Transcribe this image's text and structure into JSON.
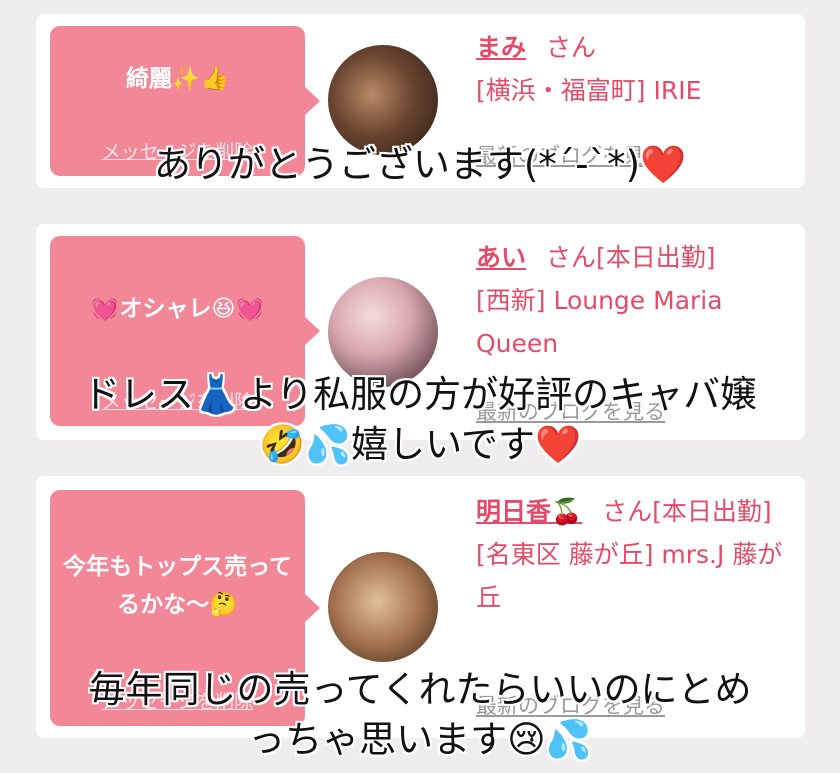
{
  "cards": [
    {
      "message": "綺麗✨👍",
      "delete_label": "メッセージを削除",
      "name": "まみ",
      "honorific": "さん",
      "shop": "[横浜・福富町] IRIE",
      "latest_blog": "最新のブログを見る"
    },
    {
      "message": "💓オシャレ😆💓",
      "delete_label": "メッセージを削除",
      "name": "あい",
      "honorific": "さん[本日出勤]",
      "shop": "[西新] Lounge Maria Queen",
      "latest_blog": "最新のブログを見る"
    },
    {
      "message": "今年もトップス売ってるかな〜🤔",
      "delete_label": "メッセージを削除",
      "name": "明日香🍒",
      "honorific": "さん[本日出勤]",
      "shop": "[名東区 藤が丘] mrs.J 藤が丘",
      "latest_blog": "最新のブログを見る"
    }
  ],
  "captions": [
    [
      "ありがとうございます(*´-`*)❤️"
    ],
    [
      "ドレス👗より私服の方が好評のキャバ嬢",
      "🤣💦嬉しいです❤️"
    ],
    [
      "毎年同じの売ってくれたらいいのにとめ",
      "っちゃ思います😢💦"
    ]
  ],
  "colors": {
    "bubble": "#f28797",
    "link_text": "#e34c68",
    "muted_link": "#9a9a9a",
    "background": "#efeded"
  }
}
